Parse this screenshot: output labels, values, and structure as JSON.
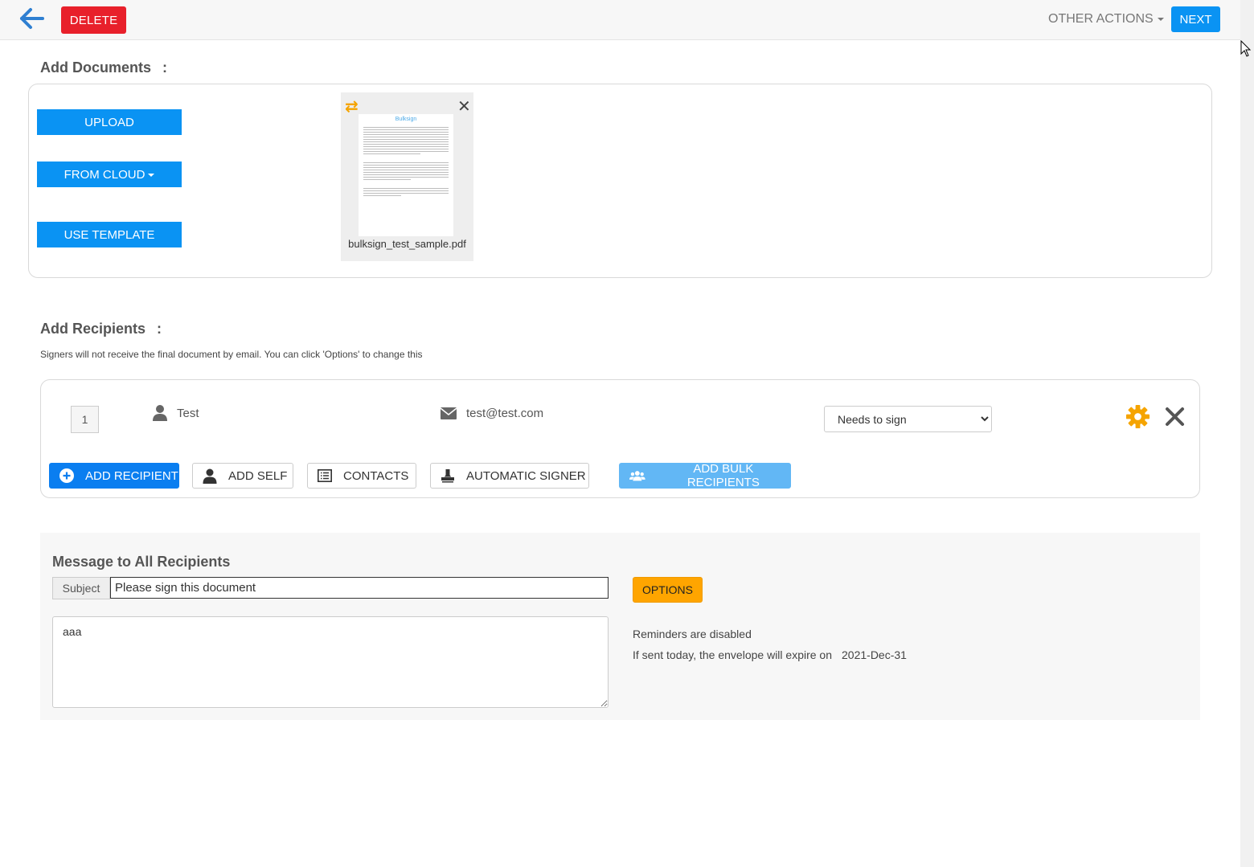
{
  "toolbar": {
    "delete_label": "DELETE",
    "other_actions_label": "OTHER ACTIONS",
    "next_label": "NEXT"
  },
  "documents": {
    "title": "Add Documents",
    "colon": ":",
    "upload_label": "UPLOAD",
    "from_cloud_label": "FROM CLOUD",
    "use_template_label": "USE TEMPLATE",
    "file": {
      "name": "bulksign_test_sample.pdf",
      "preview_title": "Bulksign"
    }
  },
  "recipients": {
    "title": "Add Recipients",
    "colon": ":",
    "helper": "Signers will not receive the final document by email. You can click 'Options' to change this",
    "list": [
      {
        "order": "1",
        "name": "Test",
        "email": "test@test.com",
        "role": "Needs to sign"
      }
    ],
    "buttons": {
      "add_recipient": "ADD RECIPIENT",
      "add_self": "ADD SELF",
      "contacts": "CONTACTS",
      "automatic_signer": "AUTOMATIC SIGNER",
      "add_bulk": "ADD BULK RECIPIENTS"
    }
  },
  "message": {
    "title": "Message to All Recipients",
    "subject_label": "Subject",
    "subject_value": "Please sign this document",
    "body": "aaa",
    "options_label": "OPTIONS",
    "reminders": "Reminders are disabled",
    "expire_text": "If sent today, the envelope will expire on",
    "expire_date": "2021-Dec-31"
  },
  "colors": {
    "primary": "#0a93f3",
    "danger": "#e8202b",
    "warning": "#ffa500"
  }
}
